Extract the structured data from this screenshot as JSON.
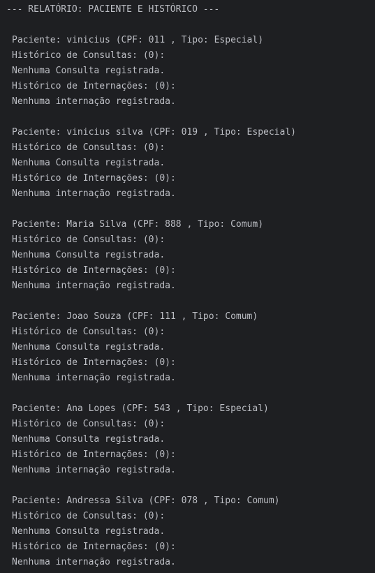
{
  "report": {
    "header": "--- RELATÓRIO: PACIENTE E HISTÓRICO ---",
    "patients": [
      {
        "line": "Paciente: vinicius (CPF: 011 , Tipo: Especial)",
        "consultas_header": "Histórico de Consultas: (0):",
        "consultas_empty": "Nenhuma Consulta registrada.",
        "internacoes_header": "Histórico de Internações: (0):",
        "internacoes_empty": "Nenhuma internação registrada."
      },
      {
        "line": "Paciente: vinicius silva (CPF: 019 , Tipo: Especial)",
        "consultas_header": "Histórico de Consultas: (0):",
        "consultas_empty": "Nenhuma Consulta registrada.",
        "internacoes_header": "Histórico de Internações: (0):",
        "internacoes_empty": "Nenhuma internação registrada."
      },
      {
        "line": "Paciente: Maria Silva (CPF: 888 , Tipo: Comum)",
        "consultas_header": "Histórico de Consultas: (0):",
        "consultas_empty": "Nenhuma Consulta registrada.",
        "internacoes_header": "Histórico de Internações: (0):",
        "internacoes_empty": "Nenhuma internação registrada."
      },
      {
        "line": "Paciente: Joao Souza (CPF: 111 , Tipo: Comum)",
        "consultas_header": "Histórico de Consultas: (0):",
        "consultas_empty": "Nenhuma Consulta registrada.",
        "internacoes_header": "Histórico de Internações: (0):",
        "internacoes_empty": "Nenhuma internação registrada."
      },
      {
        "line": "Paciente: Ana Lopes (CPF: 543 , Tipo: Especial)",
        "consultas_header": "Histórico de Consultas: (0):",
        "consultas_empty": "Nenhuma Consulta registrada.",
        "internacoes_header": "Histórico de Internações: (0):",
        "internacoes_empty": "Nenhuma internação registrada."
      },
      {
        "line": "Paciente: Andressa Silva (CPF: 078 , Tipo: Comum)",
        "consultas_header": "Histórico de Consultas: (0):",
        "consultas_empty": "Nenhuma Consulta registrada.",
        "internacoes_header": "Histórico de Internações: (0):",
        "internacoes_empty": "Nenhuma internação registrada."
      }
    ]
  },
  "colors": {
    "background": "#1e1f22",
    "text": "#bcbec4"
  }
}
